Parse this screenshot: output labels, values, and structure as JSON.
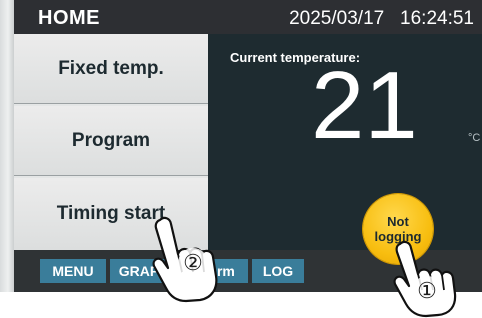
{
  "header": {
    "title": "HOME",
    "datetime": "2025/03/17   16:24:51"
  },
  "nav": {
    "items": [
      {
        "label": "Fixed temp."
      },
      {
        "label": "Program"
      },
      {
        "label": "Timing start"
      }
    ]
  },
  "main": {
    "current_label": "Current temperature:",
    "temperature": "21",
    "unit": "°C",
    "logging_button": "Not logging"
  },
  "bottom": {
    "tabs": [
      "MENU",
      "GRAPH",
      "Alarm",
      "LOG"
    ]
  },
  "annotations": {
    "marker_1": "①",
    "marker_2": "②"
  },
  "colors": {
    "screen_bg": "#1e2b30",
    "tab_bg": "#3a7d9a",
    "logging_button": "#f8be10"
  }
}
